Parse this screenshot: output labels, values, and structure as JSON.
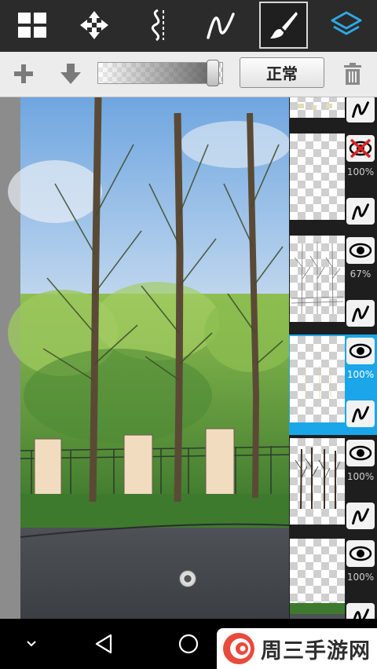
{
  "toolbar": {
    "tools": [
      {
        "icon": "grid-menu-icon"
      },
      {
        "icon": "move-arrows-icon"
      },
      {
        "icon": "symmetry-ruler-icon"
      },
      {
        "icon": "stroke-curve-icon"
      },
      {
        "icon": "brush-icon",
        "active": true
      },
      {
        "icon": "layers-icon",
        "color": "#2fa8e6"
      }
    ]
  },
  "layer_bar": {
    "add_icon": "plus-icon",
    "merge_down_icon": "arrow-down-icon",
    "opacity_value": 0.95,
    "blend_mode_label": "正常",
    "delete_icon": "trash-icon"
  },
  "canvas": {
    "scroll_handle_icon": "canvas-handle-icon"
  },
  "layers": [
    {
      "thumb": "leaves",
      "visibility_icon": "hidden-x-icon",
      "opacity_label": "",
      "selected": false
    },
    {
      "thumb": "empty",
      "visibility_icon": "hidden-x-icon",
      "opacity_label": "100%",
      "selected": false
    },
    {
      "thumb": "sketch-trees",
      "visibility_icon": "eye-icon",
      "opacity_label": "67%",
      "selected": false
    },
    {
      "thumb": "faint",
      "visibility_icon": "eye-icon",
      "opacity_label": "100%",
      "selected": true
    },
    {
      "thumb": "trees",
      "visibility_icon": "eye-icon",
      "opacity_label": "100%",
      "selected": false
    },
    {
      "thumb": "grass",
      "visibility_icon": "eye-icon",
      "opacity_label": "100%",
      "selected": false
    }
  ],
  "navbar": {
    "buttons": [
      "chevron-down-icon",
      "back-icon",
      "home-icon"
    ]
  },
  "watermark": {
    "text": "周三手游网",
    "logo_color": "#e84a3c"
  },
  "colors": {
    "selected_layer": "#1aa6e8",
    "toolbar_bg": "#2b2b2b",
    "panel_bg": "#1e1e1e"
  }
}
